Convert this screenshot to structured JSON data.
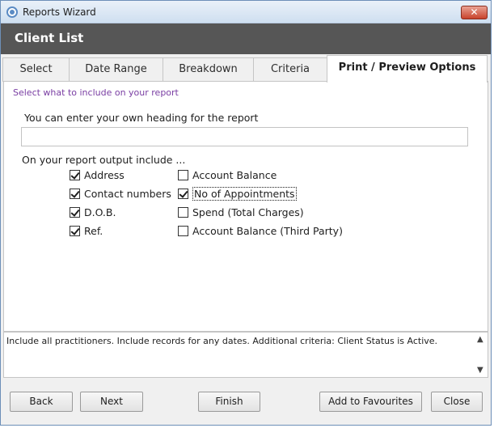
{
  "window": {
    "title": "Reports Wizard",
    "close_glyph": "✕"
  },
  "header": {
    "title": "Client List"
  },
  "tabs": [
    {
      "label": "Select"
    },
    {
      "label": "Date Range"
    },
    {
      "label": "Breakdown"
    },
    {
      "label": "Criteria"
    },
    {
      "label": "Print / Preview Options"
    }
  ],
  "panel": {
    "hint": "Select what to include on your report",
    "heading_label": "You can enter your own heading for the report",
    "heading_value": "",
    "include_label": "On your report output include ...",
    "checkboxes_left": [
      {
        "label": "Address",
        "checked": true
      },
      {
        "label": "Contact numbers",
        "checked": true
      },
      {
        "label": "D.O.B.",
        "checked": true
      },
      {
        "label": "Ref.",
        "checked": true
      }
    ],
    "checkboxes_right": [
      {
        "label": "Account Balance",
        "checked": false
      },
      {
        "label": "No of Appointments",
        "checked": true
      },
      {
        "label": "Spend (Total Charges)",
        "checked": false
      },
      {
        "label": "Account Balance (Third Party)",
        "checked": false
      }
    ]
  },
  "info": {
    "text": "Include all practitioners. Include records for any dates. Additional criteria: Client Status is Active.",
    "scroll_up": "▲",
    "scroll_down": "▼"
  },
  "buttons": {
    "back": "Back",
    "next": "Next",
    "finish": "Finish",
    "add_to_favourites": "Add to Favourites",
    "close": "Close"
  }
}
